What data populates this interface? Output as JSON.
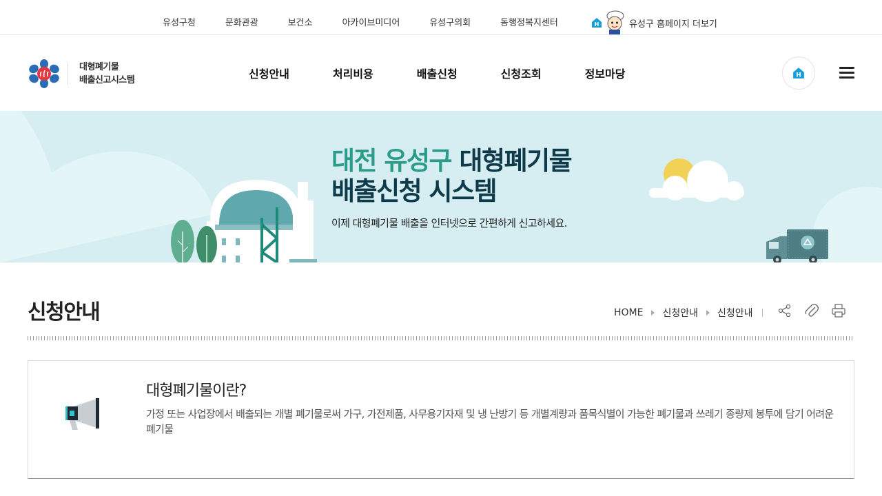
{
  "topbar": {
    "links": [
      {
        "label": "유성구청"
      },
      {
        "label": "문화관광"
      },
      {
        "label": "보건소"
      },
      {
        "label": "아카이브미디어"
      },
      {
        "label": "유성구의회"
      },
      {
        "label": "동행정복지센터"
      }
    ],
    "more_label": "유성구 홈페이지 더보기"
  },
  "header": {
    "logo_line1": "대형폐기물",
    "logo_line2": "배출신고시스템",
    "nav": [
      {
        "label": "신청안내"
      },
      {
        "label": "처리비용"
      },
      {
        "label": "배출신청"
      },
      {
        "label": "신청조회"
      },
      {
        "label": "정보마당"
      }
    ],
    "home_icon": "home-h-icon",
    "menu_icon": "hamburger-icon"
  },
  "banner": {
    "title_accent": "대전 유성구",
    "title_rest": " 대형폐기물",
    "title_line2": "배출신청 시스템",
    "subtitle": "이제 대형폐기물 배출을 인터넷으로 간편하게 신고하세요."
  },
  "page": {
    "title": "신청안내",
    "breadcrumb": [
      "HOME",
      "신청안내",
      "신청안내"
    ],
    "tools": [
      "share-icon",
      "attach-icon",
      "print-icon"
    ]
  },
  "info": {
    "title": "대형폐기물이란?",
    "description": "가정 또는 사업장에서 배출되는 개별 폐기물로써 가구, 가전제품, 사무용기자재 및 냉 난방기 등 개별계량과 품목식별이 가능한 폐기물과 쓰레기 종량제 봉투에 담기 어려운 폐기물"
  },
  "colors": {
    "banner_bg": "#d6eef2",
    "accent_teal": "#2b9c8a",
    "title_navy": "#0f3a4a",
    "logo_blue": "#2a6cb8",
    "logo_red": "#e2373f",
    "home_blue": "#169fd8"
  }
}
